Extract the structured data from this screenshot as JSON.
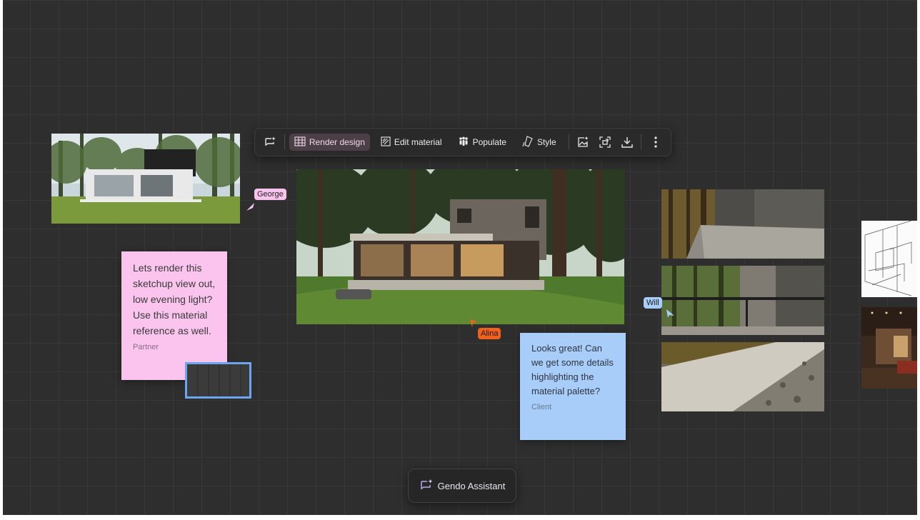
{
  "toolbar": {
    "chat_icon": "chat-sparkle-icon",
    "render_design": "Render design",
    "edit_material": "Edit material",
    "populate": "Populate",
    "style": "Style",
    "image_gen_icon": "image-sparkle-icon",
    "upscale_icon": "upscale-icon",
    "download_icon": "download-icon",
    "more_icon": "more-vertical-icon",
    "active_color": "#4b4046"
  },
  "notes": {
    "partner": {
      "text": "Lets render this sketchup view out, low evening light? Use this material reference as well.",
      "author": "Partner",
      "color": "#fbc4ee"
    },
    "client": {
      "text": "Looks great! Can we get some details highlighting the material palette?",
      "author": "Client",
      "color": "#a9cdf9"
    }
  },
  "cursors": {
    "george": {
      "name": "George",
      "color": "#fbc4ee"
    },
    "alina": {
      "name": "Alina",
      "color": "#f2601c"
    },
    "will": {
      "name": "Will",
      "color": "#a9cdf9"
    }
  },
  "assistant": {
    "label": "Gendo Assistant",
    "icon": "chat-sparkle-icon"
  }
}
